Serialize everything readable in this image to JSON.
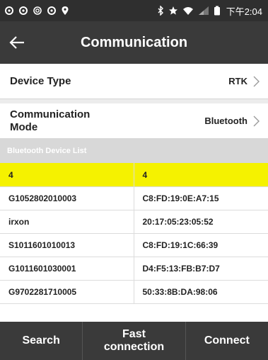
{
  "status_bar": {
    "time": "下午2:04",
    "left_icons": [
      "notification-icon",
      "notification-icon",
      "settings-icon",
      "notification-icon",
      "location-icon"
    ],
    "right_icons": [
      "bluetooth-icon",
      "star-icon",
      "wifi-icon",
      "signal-icon",
      "battery-icon"
    ]
  },
  "header": {
    "title": "Communication"
  },
  "settings": {
    "device_type_label": "Device Type",
    "device_type_value": "RTK",
    "comm_mode_label": "Communication Mode",
    "comm_mode_value": "Bluetooth"
  },
  "device_list": {
    "header": "Bluetooth Device List",
    "selected_index": 0,
    "rows": [
      {
        "name": "4",
        "address": "4"
      },
      {
        "name": "G1052802010003",
        "address": "C8:FD:19:0E:A7:15"
      },
      {
        "name": "irxon",
        "address": "20:17:05:23:05:52"
      },
      {
        "name": "S1011601010013",
        "address": "C8:FD:19:1C:66:39"
      },
      {
        "name": "G1011601030001",
        "address": "D4:F5:13:FB:B7:D7"
      },
      {
        "name": "G9702281710005",
        "address": "50:33:8B:DA:98:06"
      }
    ]
  },
  "bottom_bar": {
    "search_label": "Search",
    "fast_connection_label": "Fast connection",
    "connect_label": "Connect"
  },
  "colors": {
    "selected_row": "#f5f200",
    "bar_background": "#3a3a3a",
    "status_bar_background": "#2f2f2f",
    "section_header_background": "#d8d8d8"
  }
}
